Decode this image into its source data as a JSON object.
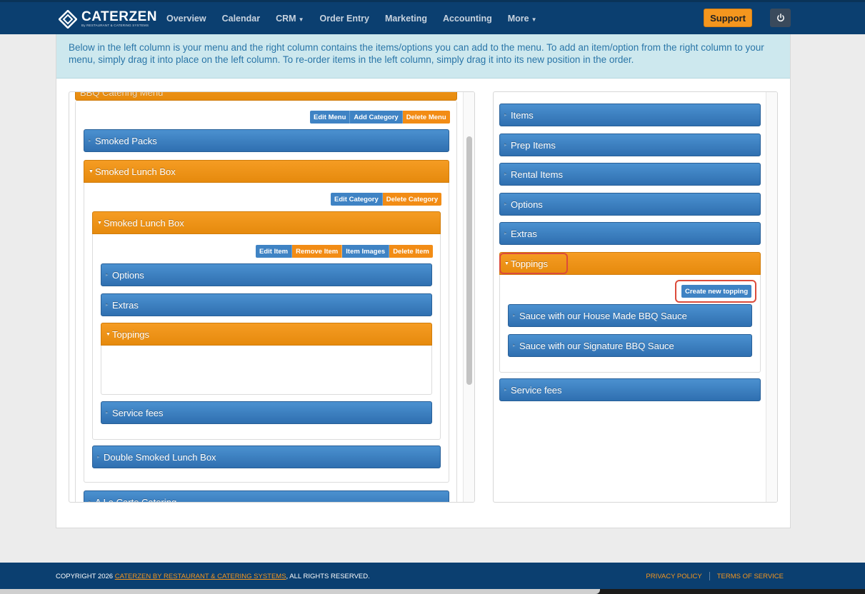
{
  "nav": {
    "logo_name": "CATERZEN",
    "logo_sub": "By RESTAURANT & CATERING SYSTEMS",
    "links": [
      "Overview",
      "Calendar",
      "CRM",
      "Order Entry",
      "Marketing",
      "Accounting",
      "More"
    ],
    "support_label": "Support"
  },
  "info_text": "Below in the left column is your menu and the right column contains the items/options you can add to the menu. To add an item/option from the right column to your menu, simply drag it into place on the left column. To re-order items in the left column, simply drag it into its new position in the order.",
  "left": {
    "menu_title": "BBQ Catering Menu",
    "menu_buttons": [
      "Edit Menu",
      "Add Category",
      "Delete Menu"
    ],
    "category_1": "Smoked Packs",
    "category_2": "Smoked Lunch Box",
    "category_buttons": [
      "Edit Category",
      "Delete Category"
    ],
    "item": "Smoked Lunch Box",
    "item_buttons": [
      "Edit Item",
      "Remove Item",
      "Item Images",
      "Delete Item"
    ],
    "sub_options": "Options",
    "sub_extras": "Extras",
    "sub_toppings": "Toppings",
    "sub_service_fees": "Service fees",
    "item_2": "Double Smoked Lunch Box",
    "category_3": "A La Carte Catering"
  },
  "right": {
    "items": "Items",
    "prep_items": "Prep Items",
    "rental_items": "Rental Items",
    "options": "Options",
    "extras": "Extras",
    "toppings": "Toppings",
    "create_topping": "Create new topping",
    "topping_1": "Sauce with our House Made BBQ Sauce",
    "topping_2": "Sauce with our Signature BBQ Sauce",
    "service_fees": "Service fees"
  },
  "footer": {
    "copyright_prefix": "COPYRIGHT 2026",
    "company_link": "CATERZEN BY RESTAURANT & CATERING SYSTEMS",
    "copyright_suffix": ", ALL RIGHTS RESERVED.",
    "privacy": "PRIVACY POLICY",
    "terms": "TERMS OF SERVICE"
  },
  "colors": {
    "nav_bg": "#0b3f70",
    "accent_orange": "#f4961e",
    "bar_blue": "#2f6fb0",
    "highlight_red": "#dc4b3a",
    "info_bg": "#cde8ee"
  }
}
